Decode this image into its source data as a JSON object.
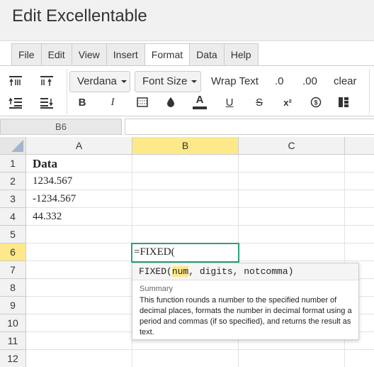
{
  "app": {
    "title": "Edit Excellentable"
  },
  "menu": {
    "tabs": [
      "File",
      "Edit",
      "View",
      "Insert",
      "Format",
      "Data",
      "Help"
    ],
    "active": "Format"
  },
  "toolbar": {
    "font_family": "Verdana",
    "font_size": "Font Size",
    "wrap_text": "Wrap Text",
    "decrease_decimal": ".0",
    "increase_decimal": ".00",
    "clear": "clear",
    "bold": "B",
    "italic": "I",
    "text_color": "A",
    "underline": "U",
    "strikethrough": "S",
    "superscript": "x²",
    "icons": [
      "align-top-icon",
      "align-middle-icon",
      "indent-icon",
      "outdent-icon",
      "border-icon",
      "fill-color-icon",
      "currency-icon",
      "merge-cells-icon"
    ],
    "text_color_bar": "#333333"
  },
  "formula_bar": {
    "cell_ref": "B6",
    "value": ""
  },
  "grid": {
    "columns": [
      "A",
      "B",
      "C"
    ],
    "selected_column": "B",
    "rows": [
      "1",
      "2",
      "3",
      "4",
      "5",
      "6",
      "7",
      "8",
      "9",
      "10",
      "11",
      "12"
    ],
    "selected_row": "6",
    "cells": {
      "A1": "Data",
      "A2": "1234.567",
      "A3": "-1234.567",
      "A4": "44.332"
    },
    "editing_cell": {
      "ref": "B6",
      "text": "=FIXED("
    }
  },
  "autocomplete": {
    "fn_name": "FIXED(",
    "param_highlight": "num",
    "rest_params": ", digits, notcomma)",
    "summary_label": "Summary",
    "summary": "This function rounds a number to the specified number of decimal places, formats the number in decimal format using a period and commas (if so specified), and returns the result as text."
  },
  "colors": {
    "selection_header": "#fde98a",
    "active_border": "#2aa080"
  }
}
